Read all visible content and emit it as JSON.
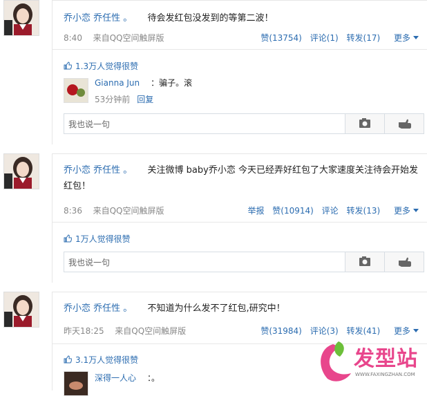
{
  "posts": [
    {
      "author": "乔小恋 乔任性 。",
      "text": "待会发红包没发到的等第二波！",
      "time": "8:40",
      "source": "来自QQ空间触屏版",
      "report": "",
      "like": "赞(13754)",
      "comment": "评论(1)",
      "repost": "转发(17)",
      "more": "更多",
      "likes_summary": "1.3万人觉得很赞",
      "comments": [
        {
          "name": "Gianna Jun",
          "text": "：骗子。滚",
          "time": "53分钟前",
          "reply": "回复"
        }
      ],
      "input_placeholder": "我也说一句"
    },
    {
      "author": "乔小恋 乔任性 。",
      "text": "关注微博 baby乔小恋 今天已经弄好红包了大家速度关注待会开始发红包！",
      "time": "8:36",
      "source": "来自QQ空间触屏版",
      "report": "举报",
      "like": "赞(10914)",
      "comment": "评论",
      "repost": "转发(13)",
      "more": "更多",
      "likes_summary": "1万人觉得很赞",
      "comments": [],
      "input_placeholder": "我也说一句"
    },
    {
      "author": "乔小恋 乔任性 。",
      "text": "不知道为什么发不了红包,研究中！",
      "time": "昨天18:25",
      "source": "来自QQ空间触屏版",
      "report": "",
      "like": "赞(31984)",
      "comment": "评论(3)",
      "repost": "转发(41)",
      "more": "更多",
      "likes_summary": "3.1万人觉得很赞",
      "comments": [
        {
          "name": "深得一人心",
          "text": "：。",
          "time": "",
          "reply": ""
        }
      ],
      "input_placeholder": ""
    }
  ],
  "watermark": {
    "text": "发型站",
    "url": "WWW.FAXINGZHAN.COM",
    "color": "#e8468c"
  }
}
